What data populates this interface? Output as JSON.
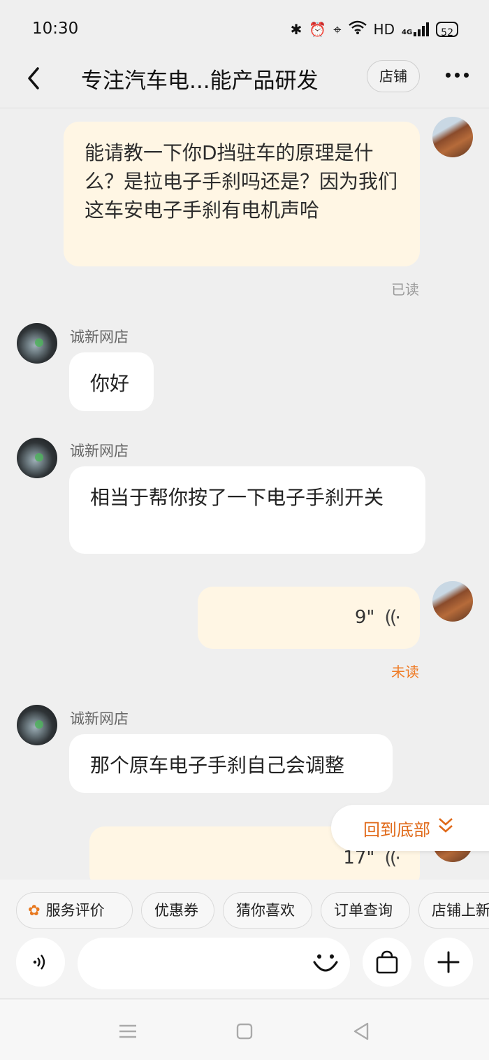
{
  "status_bar": {
    "time": "10:30",
    "network": "HD",
    "signal": "4G",
    "battery": "52"
  },
  "header": {
    "title": "专注汽车电...能产品研发",
    "shop_button": "店铺"
  },
  "messages": [
    {
      "from": "me",
      "text": "能请教一下你D挡驻车的原理是什么？是拉电子手刹吗还是？因为我们这车安电子手刹有电机声哈",
      "status": "已读"
    },
    {
      "from": "shop",
      "sender": "诚新网店",
      "text": "你好"
    },
    {
      "from": "shop",
      "sender": "诚新网店",
      "text": "相当于帮你按了一下电子手刹开关"
    },
    {
      "from": "me",
      "type": "voice",
      "duration": "9\"",
      "status": "未读"
    },
    {
      "from": "shop",
      "sender": "诚新网店",
      "text": "那个原车电子手刹自己会调整"
    },
    {
      "from": "me",
      "type": "voice",
      "duration": "17\""
    }
  ],
  "back_to_bottom": "回到底部",
  "quick_actions": [
    "服务评价",
    "优惠券",
    "猜你喜欢",
    "订单查询",
    "店铺上新"
  ],
  "colors": {
    "accent": "#ef7b25",
    "my_bubble": "#fff6e4",
    "background": "#efefef"
  },
  "icons": [
    "back-arrow-icon",
    "more-icon",
    "voice-input-icon",
    "emoji-icon",
    "shopping-bag-icon",
    "plus-icon",
    "flower-icon",
    "chevron-double-down-icon"
  ]
}
